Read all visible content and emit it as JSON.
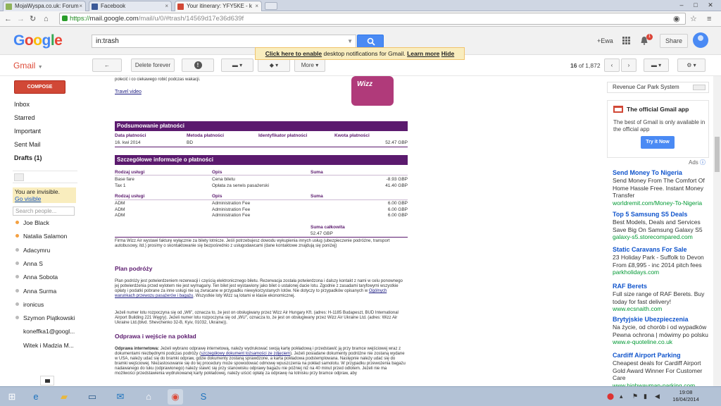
{
  "browser": {
    "tabs": [
      {
        "label": "MojaWyspa.co.uk: Forum",
        "color": "#8fb35a"
      },
      {
        "label": "Facebook",
        "color": "#3b5998"
      },
      {
        "label": "Your itinerary: YFY5KE - k",
        "color": "#d14836"
      }
    ],
    "url_secure": "https://",
    "url_host": "mail.google.com",
    "url_path": "/mail/u/0/#trash/14569d17e36d639f"
  },
  "header": {
    "logo": "Google",
    "search_value": "in:trash",
    "user_link": "+Ewa",
    "notification_count": "1",
    "share_label": "Share"
  },
  "toolbar": {
    "brand": "Gmail",
    "back_label": "←",
    "delete_forever": "Delete forever",
    "report": "!",
    "more": "More",
    "count_range": "16",
    "count_of": "of 1,872"
  },
  "notice": {
    "link": "Click here to enable",
    "text": "desktop notifications for Gmail.",
    "learn": "Learn more",
    "hide": "Hide"
  },
  "leftnav": {
    "compose": "COMPOSE",
    "items": [
      "Inbox",
      "Starred",
      "Important",
      "Sent Mail",
      "Drafts (1)"
    ],
    "invisible": "You are invisible.",
    "go_visible": "Go visible",
    "search_people": "Search people...",
    "contacts": [
      {
        "name": "Joe Black",
        "status": "#f4a142"
      },
      {
        "name": "Natalia Salamon",
        "status": "#f4a142"
      },
      {
        "name": "Adacymru",
        "status": "#bbbbbb"
      },
      {
        "name": "Anna S",
        "status": "#bbbbbb"
      },
      {
        "name": "Anna Sobota",
        "status": "#bbbbbb"
      },
      {
        "name": "Anna Surma",
        "status": "#bbbbbb"
      },
      {
        "name": "ironicus",
        "status": "#bbbbbb"
      },
      {
        "name": "Szymon Piątkowski",
        "status": "#bbbbbb"
      },
      {
        "name": "koneffka1@googl...",
        "status": "#ffffff"
      },
      {
        "name": "Witek i Madzia M...",
        "status": "#ffffff"
      }
    ]
  },
  "email": {
    "intro": "polecić i co ciekawego robić podczas wakacji.",
    "travel_video": "Travel video",
    "wizz": "Wizz",
    "payment_summary": {
      "title": "Podsumowanie płatności",
      "headers": [
        "Data płatności",
        "Metoda płatności",
        "Identyfikator płatności",
        "Kwota płatności"
      ],
      "row": [
        "16. kwi 2014",
        "BD",
        "",
        "52.47 GBP"
      ]
    },
    "payment_details": {
      "title": "Szczegółowe informacje o płatności",
      "headers": [
        "Rodzaj usługi",
        "Opis",
        "Suma"
      ],
      "rows1": [
        [
          "Base fare",
          "Cena biletu",
          "-8.93 GBP"
        ],
        [
          "Tax 1",
          "Opłata za serwis pasażerski",
          "41.40 GBP"
        ]
      ],
      "rows2": [
        [
          "ADM",
          "Administration Fee",
          "6.00 GBP"
        ],
        [
          "ADM",
          "Administration Fee",
          "6.00 GBP"
        ],
        [
          "ADM",
          "Administration Fee",
          "6.00 GBP"
        ]
      ],
      "total_label": "Suma całkowita",
      "total": "52.47 GBP"
    },
    "invoice_note": "Firma Wizz Air wystawi fakturę wyłącznie za bilety lotnicze. Jeśli potrzebujesz dowodu wykupienia innych usług (ubezpieczenie podróżne, transport autobusowy, itd.) prosimy o skontaktowanie się bezpośrednio z usługodawcami (dane kontaktowe znajdują się poniżej)",
    "plan_title": "Plan podróży",
    "plan_text1": "Plan podróży jest potwierdzeniem rezerwacji i częścią elektronicznego biletu. Rezerwacja została potwierdzona i dalszy kontakt z nami w celu ponownego jej potwierdzenia przed wylotem nie jest wymagany. Ten bilet jest wystawiony jako bilet o ustalonej dacie lotu. Zgodnie z zasadami taryfowymi wszystkie opłaty i podatki pobrane za inne usługi nie są zwracane w przypadku niewykorzystanych lotów. Nie dotyczy to przypadków opisanych w",
    "plan_link": "Ogólnych warunkach przewozu pasażerów i bagażu",
    "plan_text1_end": ". Wszystkie loty Wizz są lotami w klasie ekonomicznej.",
    "plan_text2": "Jeżeli numer lotu rozpoczyna się od „W6\", oznacza to, że jest on obsługiwany przez Wizz Air Hungary Kft. (adres: H-1185 Budapeszt, BUD International Airport Building 221 Węgry). Jeżeli numer lotu rozpoczyna się od „WU\", oznacza to, że jest on obsługiwany przez Wizz Air Ukraine Ltd. (adres: Wizz Air Ukraine Ltd.(blvd. Shevchenko 32-B, Kyiv, 01032, Ukraine)).",
    "checkin_title": "Odprawa i wejście na pokład",
    "checkin_bold": "Odprawa internetowa:",
    "checkin_text": "Jeżeli wybrano odprawę internetową, należy wydrukować swoją kartę pokładową i przedstawić ją przy bramce wejściowej wraz z dokumentami niezbędnymi podczas podróży (",
    "checkin_link": "szczegółowy dokument tożsamości ze zdjęciem",
    "checkin_text2": "). Jeżeli posiadane dokumenty podróżne nie zostaną wydane w USA, należy udać się do bramki odpraw, gdzie dokumenty zostaną sprawdzone, a karta pokładowa podstemplowana. Następnie należy udać się do bramki wejściowej. Niezastosowanie się do tej procedury może spowodować odmowę wpuszczenia na pokład samolotu. W przypadku przewożenia bagażu nadawanego do luku (odprawionego) należy stawić się przy stanowisku odprawy bagażu nie później niż na 40 minut przed odlotem. Jeżeli nie ma możliwości przedstawienia wydrukowanej karty pokładowej, należy uiścić opłatę za odprawę na lotnisku przy bramce odpraw, aby"
  },
  "rightcol": {
    "top_label": "Revenue Car Park System",
    "app_title": "The official Gmail app",
    "app_desc": "The best of Gmail is only available in the official app",
    "app_button": "Try it Now",
    "ads_label": "Ads",
    "ads": [
      {
        "head": "Send Money To Nigeria",
        "text": "Send Money From The Comfort Of Home Hassle Free. Instant Money Transfer",
        "url": "worldremit.com/Money-To-Nigeria"
      },
      {
        "head": "Top 5 Samsung S5 Deals",
        "text": "Best Models, Deals and Services Save Big On Samsung Galaxy S5",
        "url": "galaxy-s5.storecompared.com"
      },
      {
        "head": "Static Caravans For Sale",
        "text": "23 Holiday Park - Suffolk to Devon From £8,995 - inc 2014 pitch fees",
        "url": "parkholidays.com"
      },
      {
        "head": "RAF Berets",
        "text": "Full size range of RAF Berets. Buy today for fast delivery!",
        "url": "www.ecsnaith.com"
      },
      {
        "head": "Brytyjskie Ubezpieczenia",
        "text": "Na życie, od chorób i od wypadków Pewna ochrona | mówimy po polsku",
        "url": "www.e-quoteline.co.uk"
      },
      {
        "head": "Cardiff Airport Parking",
        "text": "Cheapest deals for Cardiff Airport Gold Award Winner For Customer Care",
        "url": "www.highwayman-parking.com"
      }
    ]
  },
  "taskbar": {
    "time": "19:08",
    "date": "16/04/2014"
  }
}
